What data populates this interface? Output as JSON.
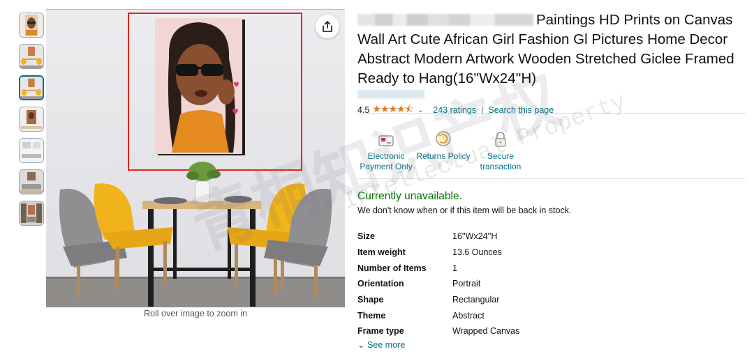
{
  "gallery": {
    "thumbnail_icons": [
      "portrait-thumbnail",
      "dining-room-thumbnail",
      "dining-room-thumbnail",
      "framed-wall-thumbnail",
      "room-wall-thumbnail",
      "sofa-room-thumbnail",
      "shelf-room-thumbnail"
    ],
    "selected_index": 2,
    "zoom_hint": "Roll over image to zoom in",
    "share_icon": "share-icon",
    "highlight_color": "#e3241d"
  },
  "product": {
    "title_rest": "Paintings HD Prints on Canvas Wall Art Cute African Girl Fashion Gl Pictures Home Decor Abstract Modern Artwork Wooden Stretched Giclee Framed Ready to Hang(16''Wx24''H)",
    "rating_value": "4.5",
    "stars": "★★★★⯪",
    "ratings_count": "243 ratings",
    "rating_separator": "|",
    "search_link": "Search this page"
  },
  "badges": [
    {
      "icon": "card-icon",
      "label": "Electronic Payment Only"
    },
    {
      "icon": "returns-icon",
      "label": "Returns Policy"
    },
    {
      "icon": "lock-icon",
      "label": "Secure transaction"
    }
  ],
  "availability": {
    "status": "Currently unavailable.",
    "detail": "We don't know when or if this item will be back in stock."
  },
  "specs": [
    {
      "key": "Size",
      "value": "16''Wx24''H"
    },
    {
      "key": "Item weight",
      "value": "13.6 Ounces"
    },
    {
      "key": "Number of Items",
      "value": "1"
    },
    {
      "key": "Orientation",
      "value": "Portrait"
    },
    {
      "key": "Shape",
      "value": "Rectangular"
    },
    {
      "key": "Theme",
      "value": "Abstract"
    },
    {
      "key": "Frame type",
      "value": "Wrapped Canvas"
    }
  ],
  "see_more": "See more",
  "watermark": {
    "latin": "Intellectual Property",
    "cjk": "青桐知识产权"
  },
  "colors": {
    "link": "#007185",
    "available": "#007600",
    "star": "#de7921"
  }
}
